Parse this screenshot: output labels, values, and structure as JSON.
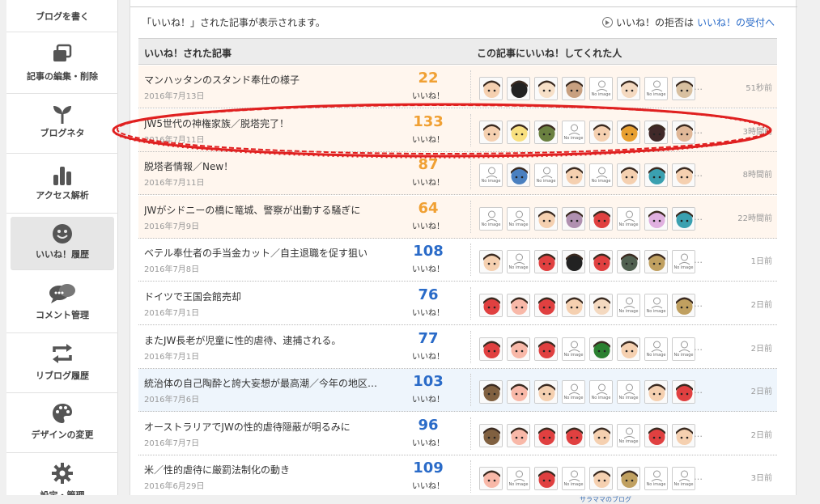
{
  "sidebar": {
    "items": [
      {
        "label": "ブログを書く",
        "icon": "pen-icon"
      },
      {
        "label": "記事の編集・削除",
        "icon": "documents-icon"
      },
      {
        "label": "ブログネタ",
        "icon": "sprout-icon"
      },
      {
        "label": "アクセス解析",
        "icon": "bar-chart-icon"
      },
      {
        "label": "いいね！履歴",
        "icon": "smiley-icon",
        "active": true
      },
      {
        "label": "コメント管理",
        "icon": "speech-bubbles-icon"
      },
      {
        "label": "リブログ履歴",
        "icon": "reblog-icon"
      },
      {
        "label": "デザインの変更",
        "icon": "palette-icon"
      },
      {
        "label": "設定・管理",
        "icon": "gear-icon"
      }
    ]
  },
  "main": {
    "description": "「いいね！」された記事が表示されます。",
    "refuse_text": "いいね！の拒否は",
    "refuse_link": "いいね！の受付へ",
    "header": {
      "col1": "いいね！された記事",
      "col2": "この記事にいいね！してくれた人"
    },
    "unit": "いいね！",
    "more": "…",
    "rows": [
      {
        "title": "マンハッタンのスタンド奉仕の様子",
        "date": "2016年7月13日",
        "count": "22",
        "ago": "51秒前"
      },
      {
        "title": "JW5世代の神権家族／脱塔完了！",
        "date": "2016年7月11日",
        "count": "133",
        "ago": "3時間前"
      },
      {
        "title": "脱塔者情報／New！",
        "date": "2016年7月11日",
        "count": "87",
        "ago": "8時間前"
      },
      {
        "title": "JWがシドニーの橋に篭城、警察が出動する騒ぎに",
        "date": "2016年7月9日",
        "count": "64",
        "ago": "22時間前"
      },
      {
        "title": "ベテル奉仕者の手当金カット／自主退職を促す狙い",
        "date": "2016年7月8日",
        "count": "108",
        "ago": "1日前"
      },
      {
        "title": "ドイツで王国会館売却",
        "date": "2016年7月1日",
        "count": "76",
        "ago": "2日前"
      },
      {
        "title": "またJW長老が児童に性的虐待、逮捕される。",
        "date": "2016年7月1日",
        "count": "77",
        "ago": "2日前"
      },
      {
        "title": "統治体の自己陶酔と誇大妄想が最高潮／今年の地区…",
        "date": "2016年7月6日",
        "count": "103",
        "ago": "2日前"
      },
      {
        "title": "オーストラリアでJWの性的虐待隠蔽が明るみに",
        "date": "2016年7月7日",
        "count": "96",
        "ago": "2日前"
      },
      {
        "title": "米／性的虐待に厳罰法制化の動き",
        "date": "2016年6月29日",
        "count": "109",
        "ago": "3日前"
      }
    ],
    "avatar_placeholder": "No image"
  },
  "footer": {
    "note": "サラママのブログ"
  },
  "colors": {
    "count_orange": "#f0a033",
    "count_blue": "#2a6bc8",
    "annotation_red": "#e02020"
  }
}
